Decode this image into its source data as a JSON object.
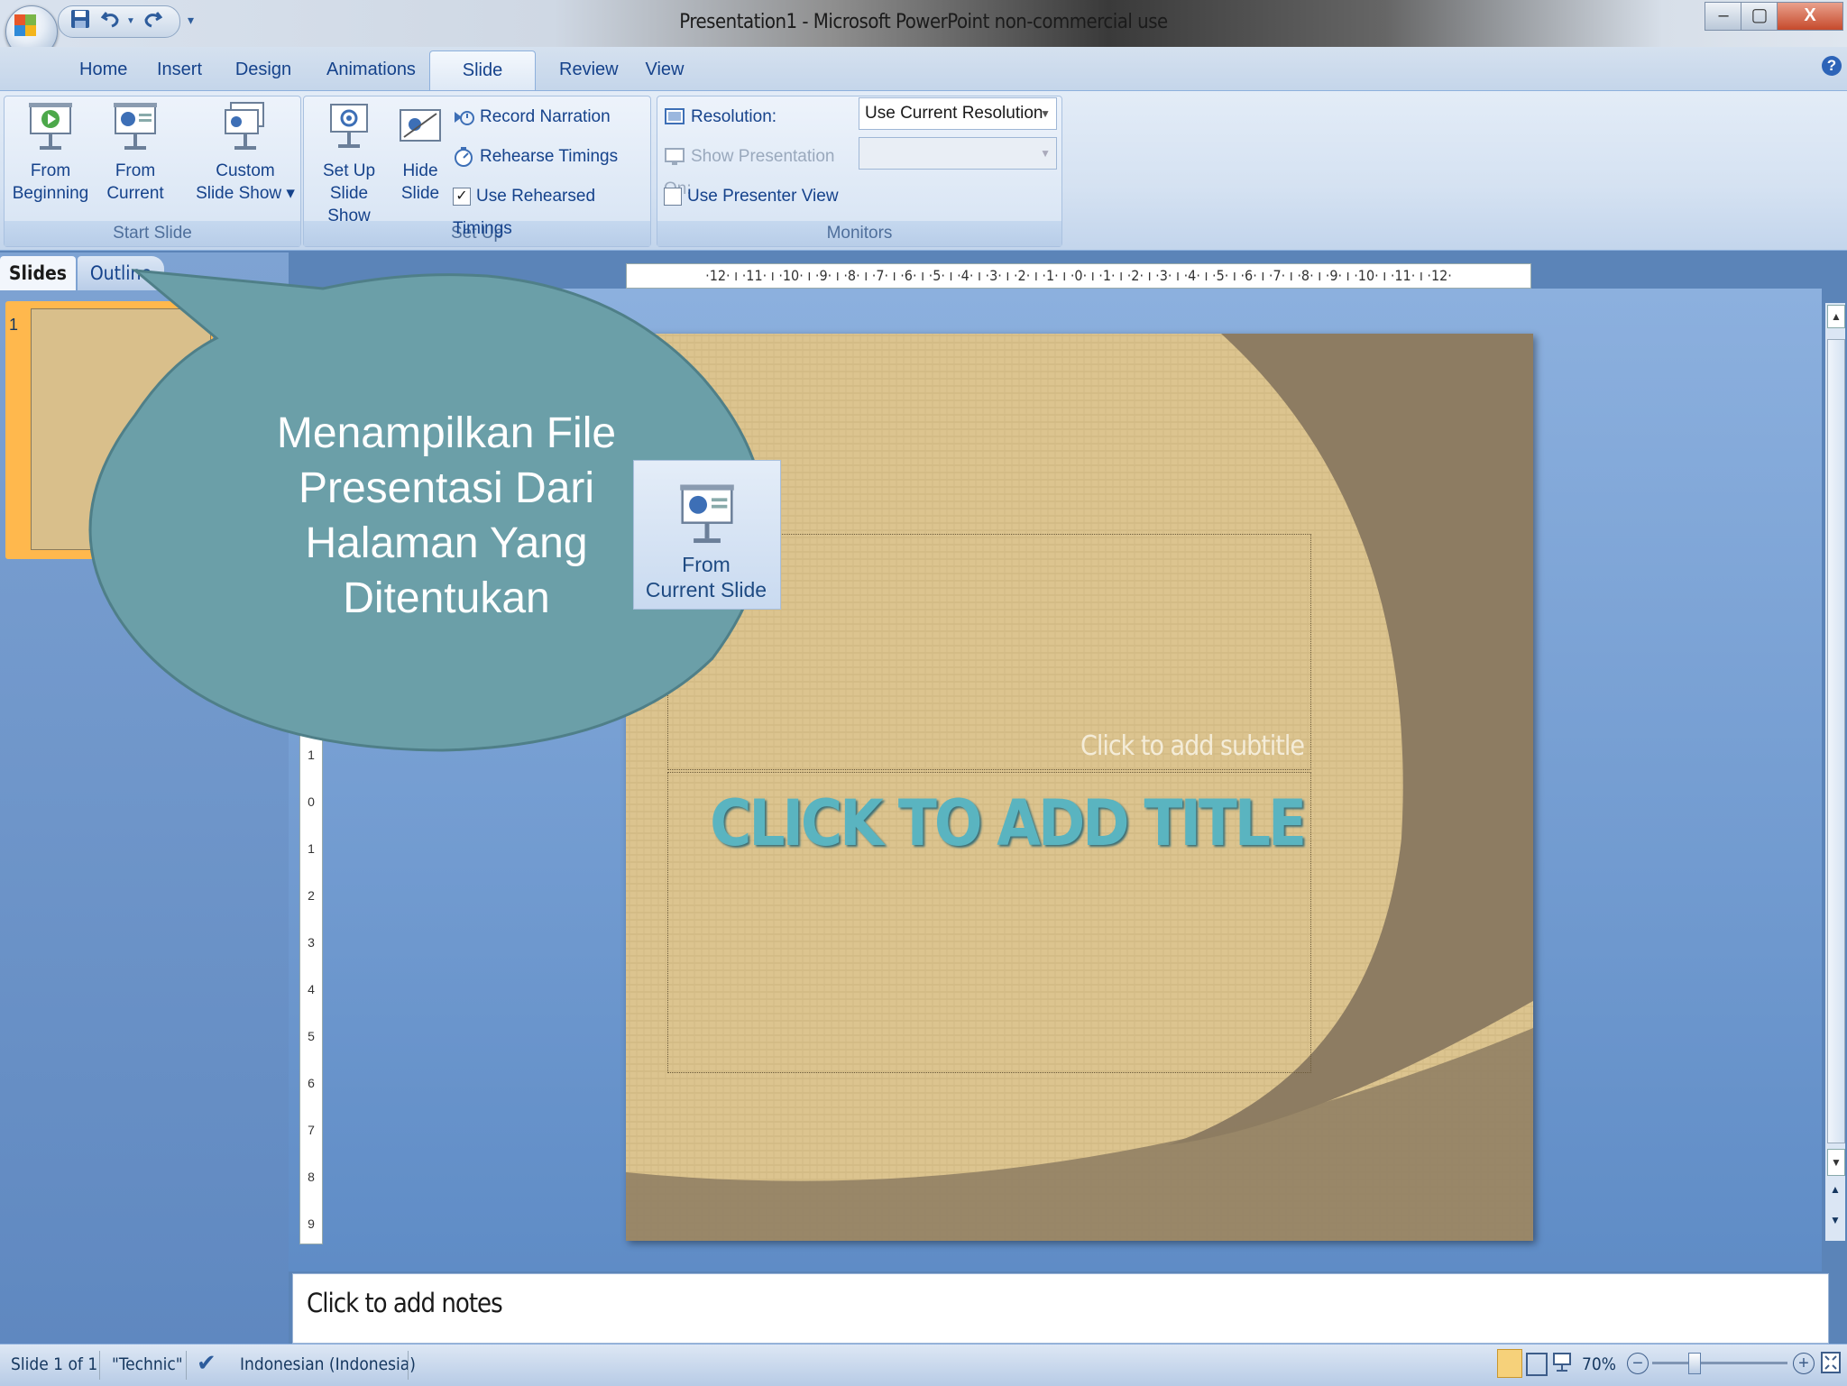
{
  "window": {
    "title": "Presentation1  -  Microsoft PowerPoint non-commercial use",
    "minimize": "–",
    "restore": "▢",
    "close": "X"
  },
  "tabs": [
    {
      "label": "Home"
    },
    {
      "label": "Insert"
    },
    {
      "label": "Design"
    },
    {
      "label": "Animations"
    },
    {
      "label": "Slide Show",
      "active": true
    },
    {
      "label": "Review"
    },
    {
      "label": "View"
    }
  ],
  "ribbon": {
    "start_group": {
      "label": "Start Slide",
      "from_beginning": [
        "From",
        "Beginning"
      ],
      "from_current": [
        "From",
        "Current"
      ],
      "custom": [
        "Custom",
        "Slide Show ▾"
      ]
    },
    "setup_group": {
      "label": "Set Up",
      "setup_show": [
        "Set Up",
        "Slide Show"
      ],
      "hide_slide": [
        "Hide",
        "Slide"
      ],
      "record_narration": "Record Narration",
      "rehearse_timings": "Rehearse Timings",
      "use_rehearsed": "Use Rehearsed Timings",
      "use_rehearsed_checked": true
    },
    "monitors_group": {
      "label": "Monitors",
      "resolution_label": "Resolution:",
      "resolution_value": "Use Current Resolution",
      "show_on_label": "Show Presentation On:",
      "show_on_value": "",
      "presenter_view": "Use Presenter View",
      "presenter_view_checked": false
    }
  },
  "panel": {
    "tab_slides": "Slides",
    "tab_outline": "Outline",
    "slide_number": "1"
  },
  "ruler": {
    "horizontal": "·12· ı ·11· ı ·10· ı ·9· ı ·8· ı ·7· ı ·6· ı ·5· ı ·4· ı ·3· ı ·2· ı ·1· ı ·0· ı ·1· ı ·2· ı ·3· ı ·4· ı ·5· ı ·6· ı ·7· ı ·8· ı ·9· ı ·10· ı ·11· ı ·12·",
    "vertical_ticks": [
      "1",
      "0",
      "1",
      "2",
      "3",
      "4",
      "5",
      "6",
      "7",
      "8",
      "9"
    ]
  },
  "slide": {
    "subtitle_placeholder": "Click to add subtitle",
    "title_placeholder": "CLICK TO ADD TITLE"
  },
  "notes": {
    "placeholder": "Click to add notes"
  },
  "callout": {
    "text": "Menampilkan File Presentasi Dari Halaman Yang Ditentukan",
    "button_label_1": "From",
    "button_label_2": "Current Slide"
  },
  "status": {
    "slide": "Slide 1 of 1",
    "theme": "\"Technic\"",
    "language": "Indonesian (Indonesia)",
    "zoom": "70%"
  },
  "colors": {
    "ribbon_text": "#15428b",
    "callout_fill": "#6b9fa8",
    "slide_bg": "#dcc48f",
    "slide_dark": "#8b7a60",
    "title_color": "#5ab4c0"
  }
}
